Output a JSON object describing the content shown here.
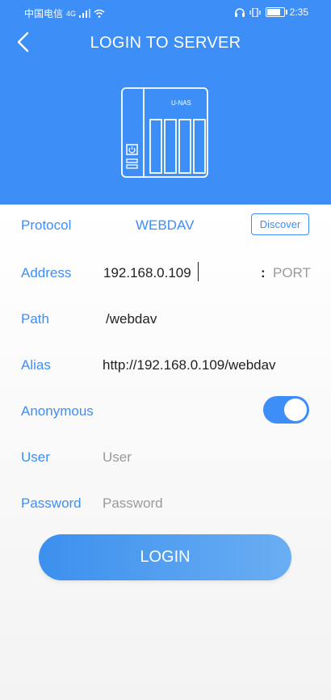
{
  "statusbar": {
    "carrier": "中国电信",
    "network": "4G",
    "time": "2:35"
  },
  "header": {
    "title": "LOGIN TO SERVER",
    "device_label": "U-NAS"
  },
  "form": {
    "protocol": {
      "label": "Protocol",
      "value": "WEBDAV",
      "discover_label": "Discover"
    },
    "address": {
      "label": "Address",
      "value": "192.168.0.109",
      "port_sep": ":",
      "port_placeholder": "PORT"
    },
    "path": {
      "label": "Path",
      "value": "/webdav"
    },
    "alias": {
      "label": "Alias",
      "value": "http://192.168.0.109/webdav"
    },
    "anonymous": {
      "label": "Anonymous",
      "enabled": true
    },
    "user": {
      "label": "User",
      "placeholder": "User"
    },
    "password": {
      "label": "Password",
      "placeholder": "Password"
    }
  },
  "login_label": "LOGIN",
  "colors": {
    "accent": "#3e8ef7",
    "button_start": "#3c90ee",
    "button_end": "#6aaef3"
  },
  "icons": [
    "back-arrow-icon",
    "nas-device-icon",
    "signal-icon",
    "wifi-icon",
    "headphones-icon",
    "vibrate-icon",
    "battery-icon"
  ]
}
